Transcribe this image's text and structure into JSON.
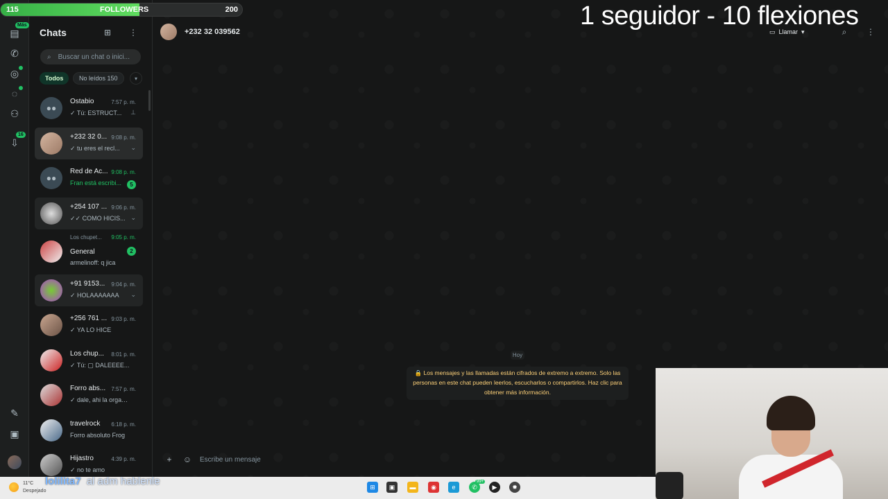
{
  "colors": {
    "accent": "#21c063",
    "background": "#161717",
    "panel": "#1d1f1f",
    "notice_text": "#ffd279"
  },
  "followers_bar": {
    "current": "115",
    "label": "FOLLOWERS",
    "goal": "200",
    "progress": 0.575
  },
  "goal_overlay": "1 seguidor - 10 flexiones",
  "rail": {
    "items": [
      {
        "icon": "chats-icon",
        "badge": "Más"
      },
      {
        "icon": "phone-icon"
      },
      {
        "icon": "status-icon"
      },
      {
        "icon": "channels-icon"
      },
      {
        "icon": "communities-icon"
      },
      {
        "icon": "archive-icon",
        "badge": "16"
      },
      {
        "icon": "starred-icon"
      },
      {
        "icon": "media-icon"
      }
    ]
  },
  "panel": {
    "title": "Chats",
    "search_placeholder": "Buscar un chat o inici...",
    "filters": [
      {
        "label": "Todos",
        "active": true
      },
      {
        "label": "No leídos 150",
        "active": false
      }
    ]
  },
  "chats": [
    {
      "name": "Ostabio",
      "time": "7:57 p. m.",
      "preview": "✓ Tú: ESTRUCT...",
      "aux": "pin-icon",
      "avatar": "group"
    },
    {
      "name": "+232 32 0...",
      "time": "9:08 p. m.",
      "preview": "✓ tu eres el recl...",
      "aux": "chevron",
      "selected": true
    },
    {
      "name": "Red de Ac...",
      "time": "9:08 p. m.",
      "time_unread": true,
      "preview": "Fran está escribi...",
      "typing": true,
      "badge": "5",
      "avatar": "group"
    },
    {
      "name": "+254 107 ...",
      "time": "9:06 p. m.",
      "preview": "✓✓ COMO HICIS...",
      "aux": "chevron",
      "hovered": true
    },
    {
      "community": "Los chupet...",
      "name": "General",
      "time": "9:05 p. m.",
      "time_unread": true,
      "preview": "armelinoff: q jica",
      "badge": "2"
    },
    {
      "name": "+91 9153...",
      "time": "9:04 p. m.",
      "preview": "✓ HOLAAAAAAA",
      "aux": "chevron",
      "hovered": true
    },
    {
      "name": "+256 761 ...",
      "time": "9:03 p. m.",
      "preview": "✓ YA LO HICE"
    },
    {
      "name": "Los chup...",
      "time": "8:01 p. m.",
      "preview": "✓ Tú: ▢ DALEEEE..."
    },
    {
      "name": "Forro abs...",
      "time": "7:57 p. m.",
      "preview": "✓ dale, ahi la organ..."
    },
    {
      "name": "travelrock",
      "time": "6:18 p. m.",
      "preview": "Forro absoluto Frog"
    },
    {
      "name": "Hijastro",
      "time": "4:39 p. m.",
      "preview": "✓ no te amo"
    }
  ],
  "conversation": {
    "title": "+232 32 039562",
    "call_label": "Llamar",
    "day_chip": "Hoy",
    "encryption_notice": "🔒 Los mensajes y las llamadas están cifrados de extremo a extremo. Solo las personas en este chat pueden leerlos, escucharlos o compartirlos. Haz clic para obtener más información.",
    "composer_placeholder": "Escribe un mensaje"
  },
  "taskbar": {
    "weather_temp": "11°C",
    "weather_desc": "Despejado",
    "whatsapp_badge": "99+",
    "icons": [
      "windows-icon",
      "task-view-icon",
      "file-explorer-icon",
      "chrome-icon",
      "edge-icon",
      "whatsapp-icon",
      "media-player-icon",
      "app-icon"
    ]
  },
  "stream_chat": {
    "user": "lolilita7",
    "message": "al adm hablenle"
  }
}
